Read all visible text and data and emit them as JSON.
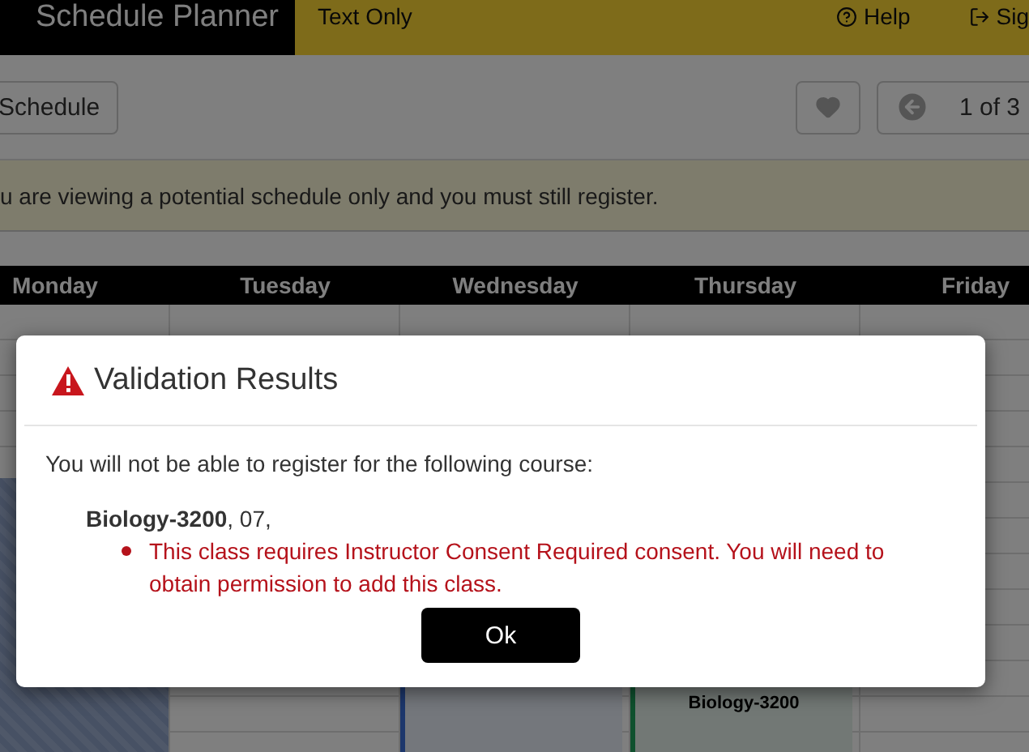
{
  "header": {
    "title": "Schedule Planner",
    "links": [
      {
        "label": "Text Only"
      },
      {
        "label": "Help"
      },
      {
        "label": "Sig"
      }
    ]
  },
  "toolbar": {
    "schedule_button": "Schedule",
    "pager": "1 of 3"
  },
  "notice": "u are viewing a potential schedule only and you must still register.",
  "days": [
    {
      "name": "Monday",
      "events": [
        {
          "kind": "hatched"
        }
      ]
    },
    {
      "name": "Tuesday"
    },
    {
      "name": "Wednesday",
      "events": [
        {
          "kind": "blue"
        }
      ]
    },
    {
      "name": "Thursday",
      "events": [
        {
          "kind": "green",
          "label": "Biology-3200"
        }
      ]
    },
    {
      "name": "Friday"
    }
  ],
  "modal": {
    "title": "Validation Results",
    "message": "You will not be able to register for the following course:",
    "course": "**Biology-3200**, 07,",
    "errors": [
      "This class requires Instructor Consent Required consent. You will need to obtain permission to add this class."
    ],
    "button": "Ok"
  }
}
